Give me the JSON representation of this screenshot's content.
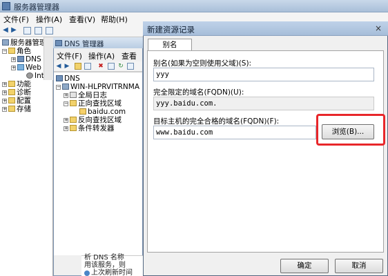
{
  "main_window": {
    "title": "服务器管理器",
    "menu": [
      "文件(F)",
      "操作(A)",
      "查看(V)",
      "帮助(H)"
    ],
    "tree": [
      {
        "label": "服务器管理器",
        "icon": "server-icon"
      },
      {
        "label": "角色",
        "icon": "folder-icon",
        "expander": "−"
      },
      {
        "label": "DNS 服务器",
        "icon": "dns-icon",
        "expander": "+"
      },
      {
        "label": "Web 服务器",
        "icon": "web-icon",
        "expander": "+"
      },
      {
        "label": "Inter",
        "icon": "gear-icon"
      },
      {
        "label": "功能",
        "icon": "folder-icon",
        "expander": "+"
      },
      {
        "label": "诊断",
        "icon": "folder-icon",
        "expander": "+"
      },
      {
        "label": "配置",
        "icon": "folder-icon",
        "expander": "+"
      },
      {
        "label": "存储",
        "icon": "folder-icon",
        "expander": "+"
      }
    ]
  },
  "dns_window": {
    "title": "DNS 管理器",
    "menu": [
      "文件(F)",
      "操作(A)",
      "查看"
    ],
    "tree": [
      {
        "label": "DNS",
        "icon": "dns-icon"
      },
      {
        "label": "WIN-HLPRVITRNMA",
        "icon": "server-icon",
        "expander": "−"
      },
      {
        "label": "全局日志",
        "icon": "log-icon",
        "expander": "+"
      },
      {
        "label": "正向查找区域",
        "icon": "folder-icon",
        "expander": "−"
      },
      {
        "label": "baidu.com",
        "icon": "zone-icon"
      },
      {
        "label": "反向查找区域",
        "icon": "folder-icon",
        "expander": "+"
      },
      {
        "label": "条件转发器",
        "icon": "folder-icon",
        "expander": "+"
      }
    ],
    "bottom_lines": [
      "析 DNS 名称",
      "用该服务，则",
      "上次刷新时间"
    ]
  },
  "dialog": {
    "title": "新建资源记录",
    "close": "×",
    "tab": "别名(CNAME)",
    "alias_label": "别名(如果为空则使用父域)(S):",
    "alias_value": "yyy",
    "fqdn_label": "完全限定的域名(FQDN)(U):",
    "fqdn_value": "yyy.baidu.com.",
    "target_label": "目标主机的完全合格的域名(FQDN)(F):",
    "target_value": "www.baidu.com",
    "browse_button": "浏览(B)...",
    "ok_button": "确定",
    "cancel_button": "取消"
  },
  "colors": {
    "highlight": "#e8262a",
    "titlebar": "#a6bdd9"
  }
}
